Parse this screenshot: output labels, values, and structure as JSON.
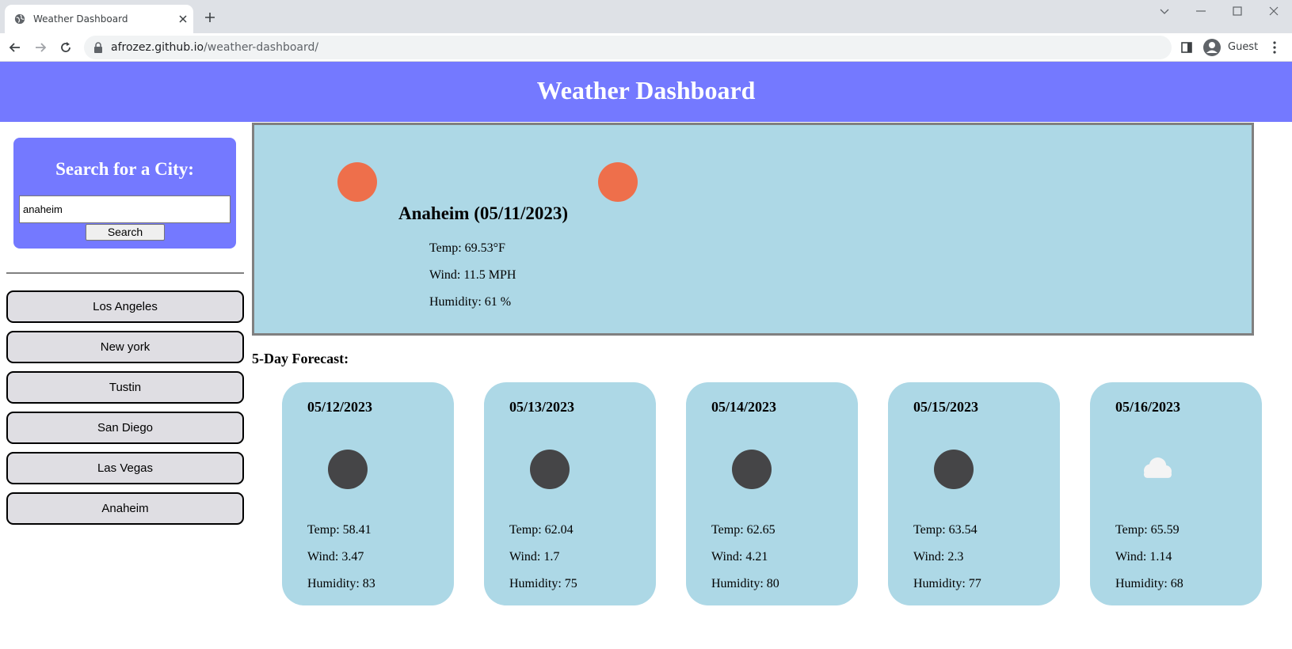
{
  "browser": {
    "tab_title": "Weather Dashboard",
    "url_host": "afrozez.github.io",
    "url_path": "/weather-dashboard/",
    "profile_label": "Guest"
  },
  "page": {
    "title": "Weather Dashboard",
    "search": {
      "heading": "Search for a City:",
      "input_value": "anaheim",
      "button_label": "Search"
    },
    "history": [
      "Los Angeles",
      "New york",
      "Tustin",
      "San Diego",
      "Las Vegas",
      "Anaheim"
    ],
    "current": {
      "heading": "Anaheim (05/11/2023)",
      "icon": "sun-icon",
      "temp": "Temp: 69.53°F",
      "wind": "Wind: 11.5 MPH",
      "humidity": "Humidity: 61 %"
    },
    "forecast_heading": "5-Day Forecast:",
    "forecast": [
      {
        "date": "05/12/2023",
        "icon": "moon-icon",
        "temp": "Temp: 58.41",
        "wind": "Wind: 3.47",
        "humidity": "Humidity: 83"
      },
      {
        "date": "05/13/2023",
        "icon": "moon-icon",
        "temp": "Temp: 62.04",
        "wind": "Wind: 1.7",
        "humidity": "Humidity: 75"
      },
      {
        "date": "05/14/2023",
        "icon": "moon-icon",
        "temp": "Temp: 62.65",
        "wind": "Wind: 4.21",
        "humidity": "Humidity: 80"
      },
      {
        "date": "05/15/2023",
        "icon": "moon-icon",
        "temp": "Temp: 63.54",
        "wind": "Wind: 2.3",
        "humidity": "Humidity: 77"
      },
      {
        "date": "05/16/2023",
        "icon": "cloud-icon",
        "temp": "Temp: 65.59",
        "wind": "Wind: 1.14",
        "humidity": "Humidity: 68"
      }
    ]
  },
  "colors": {
    "header_bg": "#7479ff",
    "card_bg": "#add8e6",
    "sun": "#ee6f4b",
    "moon": "#454547"
  }
}
